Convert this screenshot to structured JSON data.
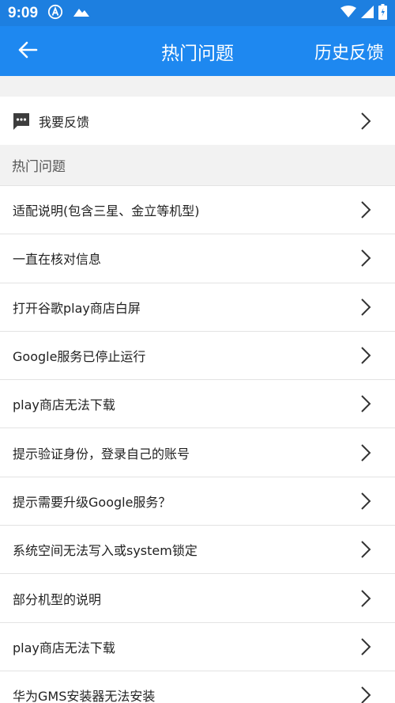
{
  "status_bar": {
    "time": "9:09",
    "icons_left": [
      "accessibility-icon",
      "cloud-icon"
    ],
    "icons_right": [
      "wifi-icon",
      "signal-icon",
      "battery-icon"
    ]
  },
  "app_bar": {
    "title": "热门问题",
    "back_icon": "arrow-left-icon",
    "history_label": "历史反馈",
    "color": "#1e88f0"
  },
  "feedback": {
    "label": "我要反馈",
    "icon": "message-icon"
  },
  "section": {
    "title": "热门问题"
  },
  "questions": [
    "适配说明(包含三星、金立等机型)",
    "一直在核对信息",
    "打开谷歌play商店白屏",
    "Google服务已停止运行",
    "play商店无法下载",
    "提示验证身份，登录自己的账号",
    "提示需要升级Google服务？",
    "系统空间无法写入或system锁定",
    "部分机型的说明",
    "play商店无法下载",
    "华为GMS安装器无法安装"
  ]
}
